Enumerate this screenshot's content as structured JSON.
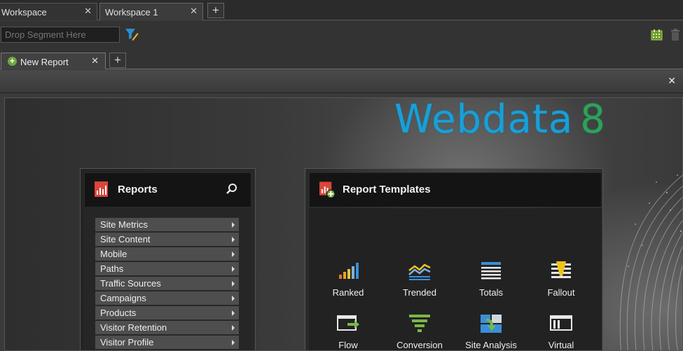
{
  "workspace_tabs": [
    {
      "label": "Workspace",
      "active": false
    },
    {
      "label": "Workspace 1",
      "active": true
    }
  ],
  "segment": {
    "placeholder": "Drop Segment Here"
  },
  "report_tabs": [
    {
      "label": "New Report"
    }
  ],
  "logo": {
    "text": "Webdata",
    "number": "8"
  },
  "reports_panel": {
    "title": "Reports",
    "items": [
      "Site Metrics",
      "Site Content",
      "Mobile",
      "Paths",
      "Traffic Sources",
      "Campaigns",
      "Products",
      "Visitor Retention",
      "Visitor Profile"
    ]
  },
  "templates_panel": {
    "title": "Report Templates",
    "items": [
      {
        "label": "Ranked",
        "icon": "ranked-icon"
      },
      {
        "label": "Trended",
        "icon": "trended-icon"
      },
      {
        "label": "Totals",
        "icon": "totals-icon"
      },
      {
        "label": "Fallout",
        "icon": "fallout-icon"
      },
      {
        "label": "Flow",
        "icon": "flow-icon"
      },
      {
        "label": "Conversion",
        "icon": "conversion-icon"
      },
      {
        "label": "Site Analysis",
        "icon": "site-analysis-icon"
      },
      {
        "label": "Virtual",
        "icon": "virtual-icon"
      }
    ]
  },
  "colors": {
    "logo_blue": "#1a9fd6",
    "logo_green": "#2fa34e",
    "report_red": "#d9463b",
    "accent_green": "#6fa63a"
  }
}
